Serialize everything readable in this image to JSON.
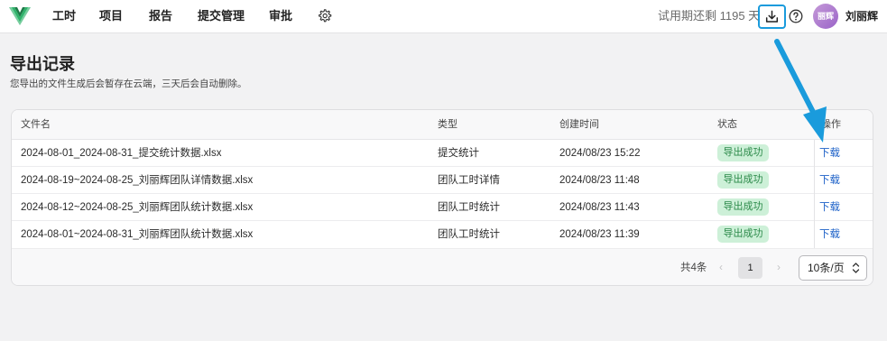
{
  "nav": {
    "items": [
      "工时",
      "项目",
      "报告",
      "提交管理",
      "审批"
    ],
    "trial_text": "试用期还剩 1195 天",
    "avatar_text": "丽辉",
    "username": "刘丽辉",
    "icons": [
      "logo-icon",
      "gear-icon",
      "download-icon",
      "help-icon"
    ]
  },
  "page": {
    "title": "导出记录",
    "subtitle": "您导出的文件生成后会暂存在云端，三天后会自动删除。"
  },
  "table": {
    "columns": [
      "文件名",
      "类型",
      "创建时间",
      "状态",
      "操作"
    ],
    "rows": [
      {
        "file": "2024-08-01_2024-08-31_提交统计数据.xlsx",
        "type": "提交统计",
        "created": "2024/08/23 15:22",
        "status": "导出成功",
        "action": "下载"
      },
      {
        "file": "2024-08-19~2024-08-25_刘丽辉团队详情数据.xlsx",
        "type": "团队工时详情",
        "created": "2024/08/23 11:48",
        "status": "导出成功",
        "action": "下载"
      },
      {
        "file": "2024-08-12~2024-08-25_刘丽辉团队统计数据.xlsx",
        "type": "团队工时统计",
        "created": "2024/08/23 11:43",
        "status": "导出成功",
        "action": "下载"
      },
      {
        "file": "2024-08-01~2024-08-31_刘丽辉团队统计数据.xlsx",
        "type": "团队工时统计",
        "created": "2024/08/23 11:39",
        "status": "导出成功",
        "action": "下载"
      }
    ]
  },
  "pagination": {
    "total": "共4条",
    "prev": "‹",
    "current": "1",
    "next": "›",
    "page_size": "10条/页"
  },
  "colors": {
    "accent_blue": "#1a9bdc",
    "success_bg": "#cdf0d8",
    "success_text": "#2c8a4a",
    "link": "#1e62c8"
  }
}
